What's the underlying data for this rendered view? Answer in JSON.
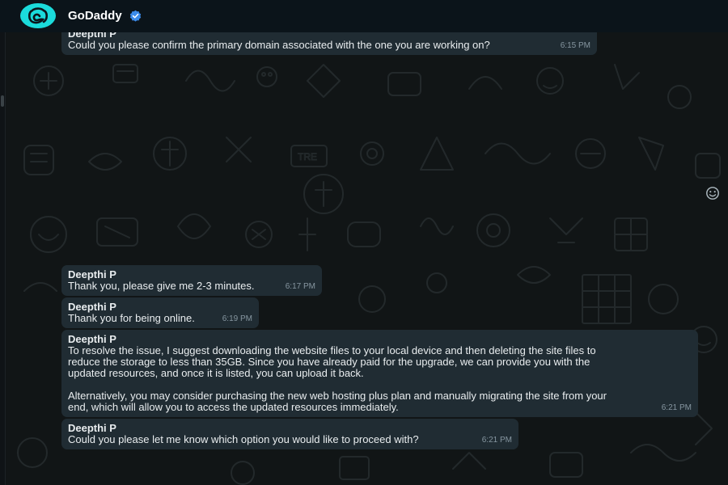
{
  "header": {
    "contact_name": "GoDaddy",
    "verified": true,
    "avatar_icon": "godaddy-logo-icon"
  },
  "colors": {
    "avatar_bg": "#1bdbdb",
    "bubble_bg": "#202c33",
    "verified_blue": "#3b8bea",
    "chat_bg": "#111516"
  },
  "messages": [
    {
      "sender": "Deepthi P",
      "text": "Could you please confirm the primary domain associated with the one you are working on?",
      "time": "6:15 PM"
    },
    {
      "sender": "Deepthi P",
      "text": "Thank you, please give me 2-3 minutes.",
      "time": "6:17 PM"
    },
    {
      "sender": "Deepthi P",
      "text": "Thank you for being online.",
      "time": "6:19 PM"
    },
    {
      "sender": "Deepthi P",
      "text": "To resolve the issue, I suggest downloading the website files to your local device and then deleting the site files to\nreduce the storage to less than 35GB. Since you have already paid for the upgrade, we can provide you with the\nupdated resources, and once it is listed, you can upload it back.\n\nAlternatively, you may consider purchasing the new web hosting plus plan and manually migrating the site from your\nend, which will allow you to access the updated resources immediately.",
      "time": "6:21 PM"
    },
    {
      "sender": "Deepthi P",
      "text": "Could you please let me know which option you would like to proceed with?",
      "time": "6:21 PM"
    }
  ],
  "icons": {
    "emoji": "smiley-emoji-icon"
  }
}
